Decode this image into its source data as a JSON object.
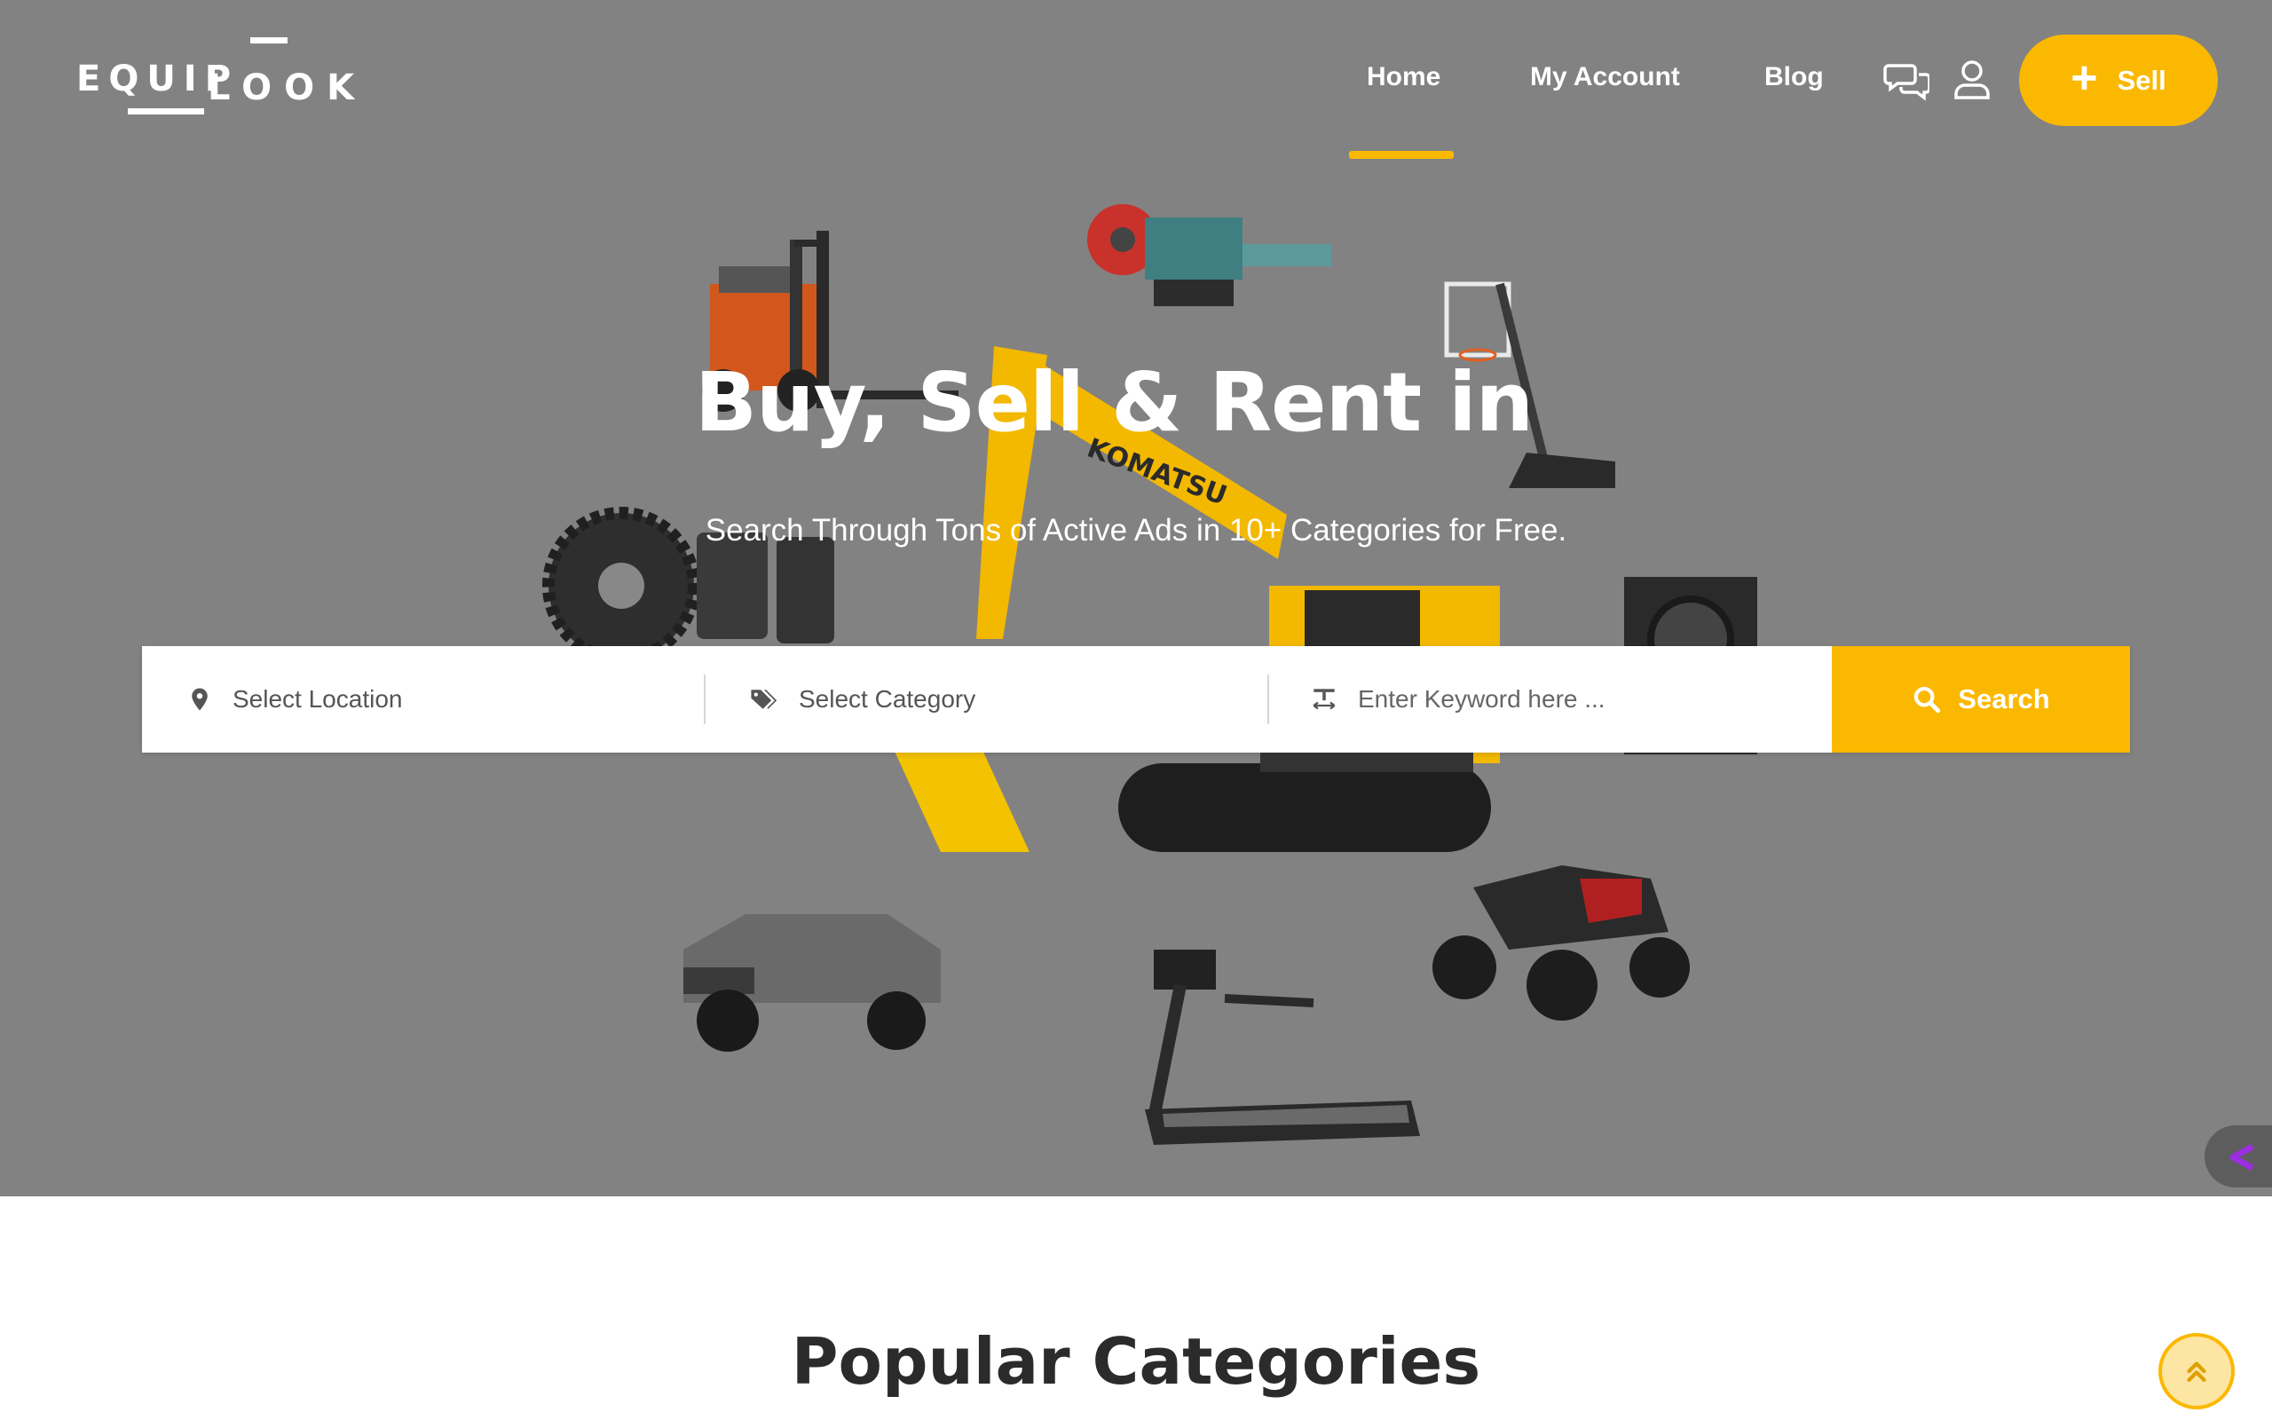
{
  "header": {
    "logo": {
      "word_top": "EQUIP",
      "word_bottom": "LOOK"
    },
    "nav": [
      {
        "label": "Home",
        "active": true
      },
      {
        "label": "My Account",
        "active": false
      },
      {
        "label": "Blog",
        "active": false
      }
    ],
    "icons": [
      "chat-icon",
      "user-icon"
    ],
    "sell_button": {
      "label": "Sell",
      "icon": "plus-icon"
    }
  },
  "hero": {
    "headline": "Buy, Sell & Rent in",
    "subheadline": "Search Through Tons of Active Ads in 10+ Categories for Free.",
    "search": {
      "location_placeholder": "Select Location",
      "category_placeholder": "Select Category",
      "keyword_placeholder": "Enter Keyword here ...",
      "button_label": "Search"
    },
    "collage_items": [
      "forklift",
      "nail machine",
      "basketball hoop",
      "excavator",
      "gear",
      "brake pads",
      "washing machine",
      "pickup truck",
      "treadmill",
      "quad bike"
    ],
    "excavator_brand": "KOMATSU"
  },
  "sections": {
    "popular_title": "Popular Categories"
  },
  "colors": {
    "accent": "#fbb800",
    "hero_overlay": "#828282",
    "text_dark": "#2b2b2b"
  }
}
